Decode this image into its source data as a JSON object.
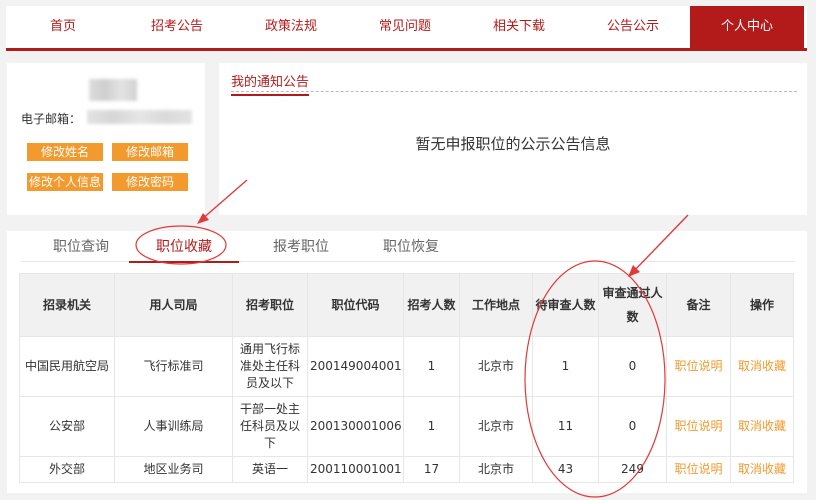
{
  "nav": {
    "items": [
      "首页",
      "招考公告",
      "政策法规",
      "常见问题",
      "相关下载",
      "公告公示",
      "个人中心"
    ],
    "active_index": 6
  },
  "profile": {
    "email_label": "电子邮箱：",
    "buttons": {
      "edit_name": "修改姓名",
      "edit_email": "修改邮箱",
      "edit_info": "修改个人信息",
      "edit_password": "修改密码"
    }
  },
  "notice": {
    "title": "我的通知公告",
    "empty_text": "暂无申报职位的公示公告信息"
  },
  "tabs": {
    "items": [
      "职位查询",
      "职位收藏",
      "报考职位",
      "职位恢复"
    ],
    "active_index": 1
  },
  "table": {
    "headers": [
      "招录机关",
      "用人司局",
      "招考职位",
      "职位代码",
      "招考人数",
      "工作地点",
      "待审查人数",
      "审查通过人数",
      "备注",
      "操作"
    ],
    "rows": [
      [
        "中国民用航空局",
        "飞行标准司",
        "通用飞行标准处主任科员及以下",
        "200149004001",
        "1",
        "北京市",
        "1",
        "0",
        "职位说明",
        "取消收藏"
      ],
      [
        "公安部",
        "人事训练局",
        "干部一处主任科员及以下",
        "200130001006",
        "1",
        "北京市",
        "11",
        "0",
        "职位说明",
        "取消收藏"
      ],
      [
        "外交部",
        "地区业务司",
        "英语一",
        "200110001001",
        "17",
        "北京市",
        "43",
        "249",
        "职位说明",
        "取消收藏"
      ]
    ]
  },
  "colors": {
    "brand_red": "#b31b1b",
    "button_orange": "#f29a2e",
    "annotation_red": "#e03a3a"
  }
}
